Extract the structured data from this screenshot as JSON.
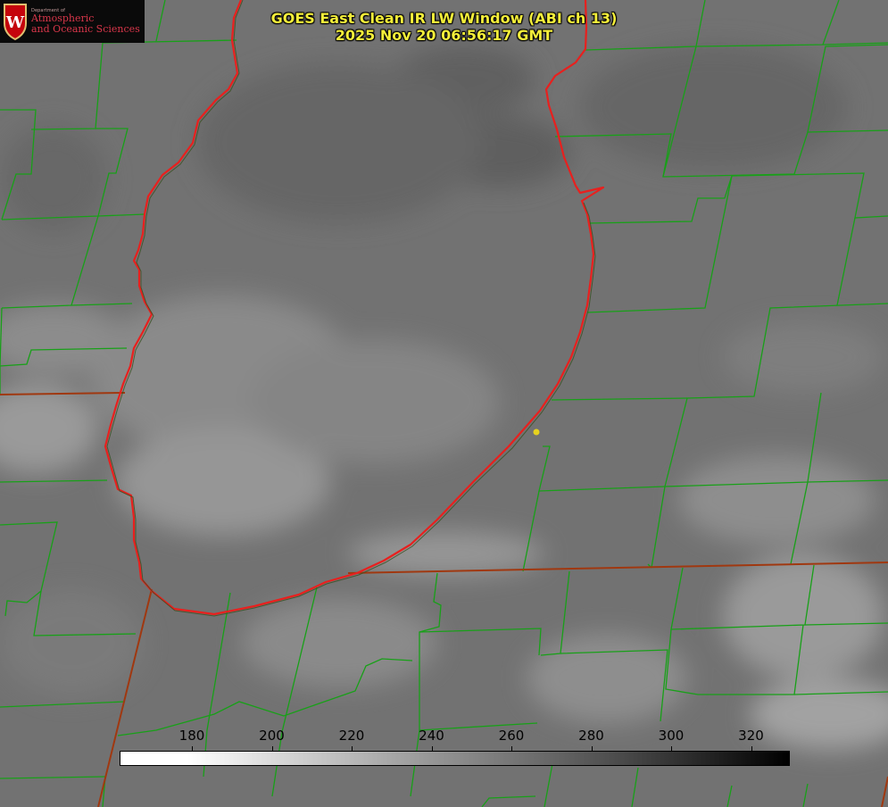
{
  "title": {
    "line1": "GOES East Clean IR LW Window (ABI ch 13)",
    "line2": "2025 Nov 20 06:56:17 GMT"
  },
  "logo": {
    "department": "Department of",
    "name_line1": "Atmospheric",
    "name_line2": "and Oceanic Sciences",
    "crest_letter": "W",
    "icon": "uw-crest-icon"
  },
  "colorbar": {
    "ticks": [
      "180",
      "200",
      "220",
      "240",
      "260",
      "280",
      "300",
      "320"
    ],
    "gradient": "white-to-black"
  },
  "colors": {
    "title": "#f4ee3a",
    "lake_outline": "#e8201e",
    "county_lines": "#18a018",
    "state_lines": "#a03810",
    "marker": "#e6d21e"
  },
  "map": {
    "features": [
      "lake-shoreline",
      "county-boundaries",
      "state-boundary",
      "location-marker"
    ]
  }
}
